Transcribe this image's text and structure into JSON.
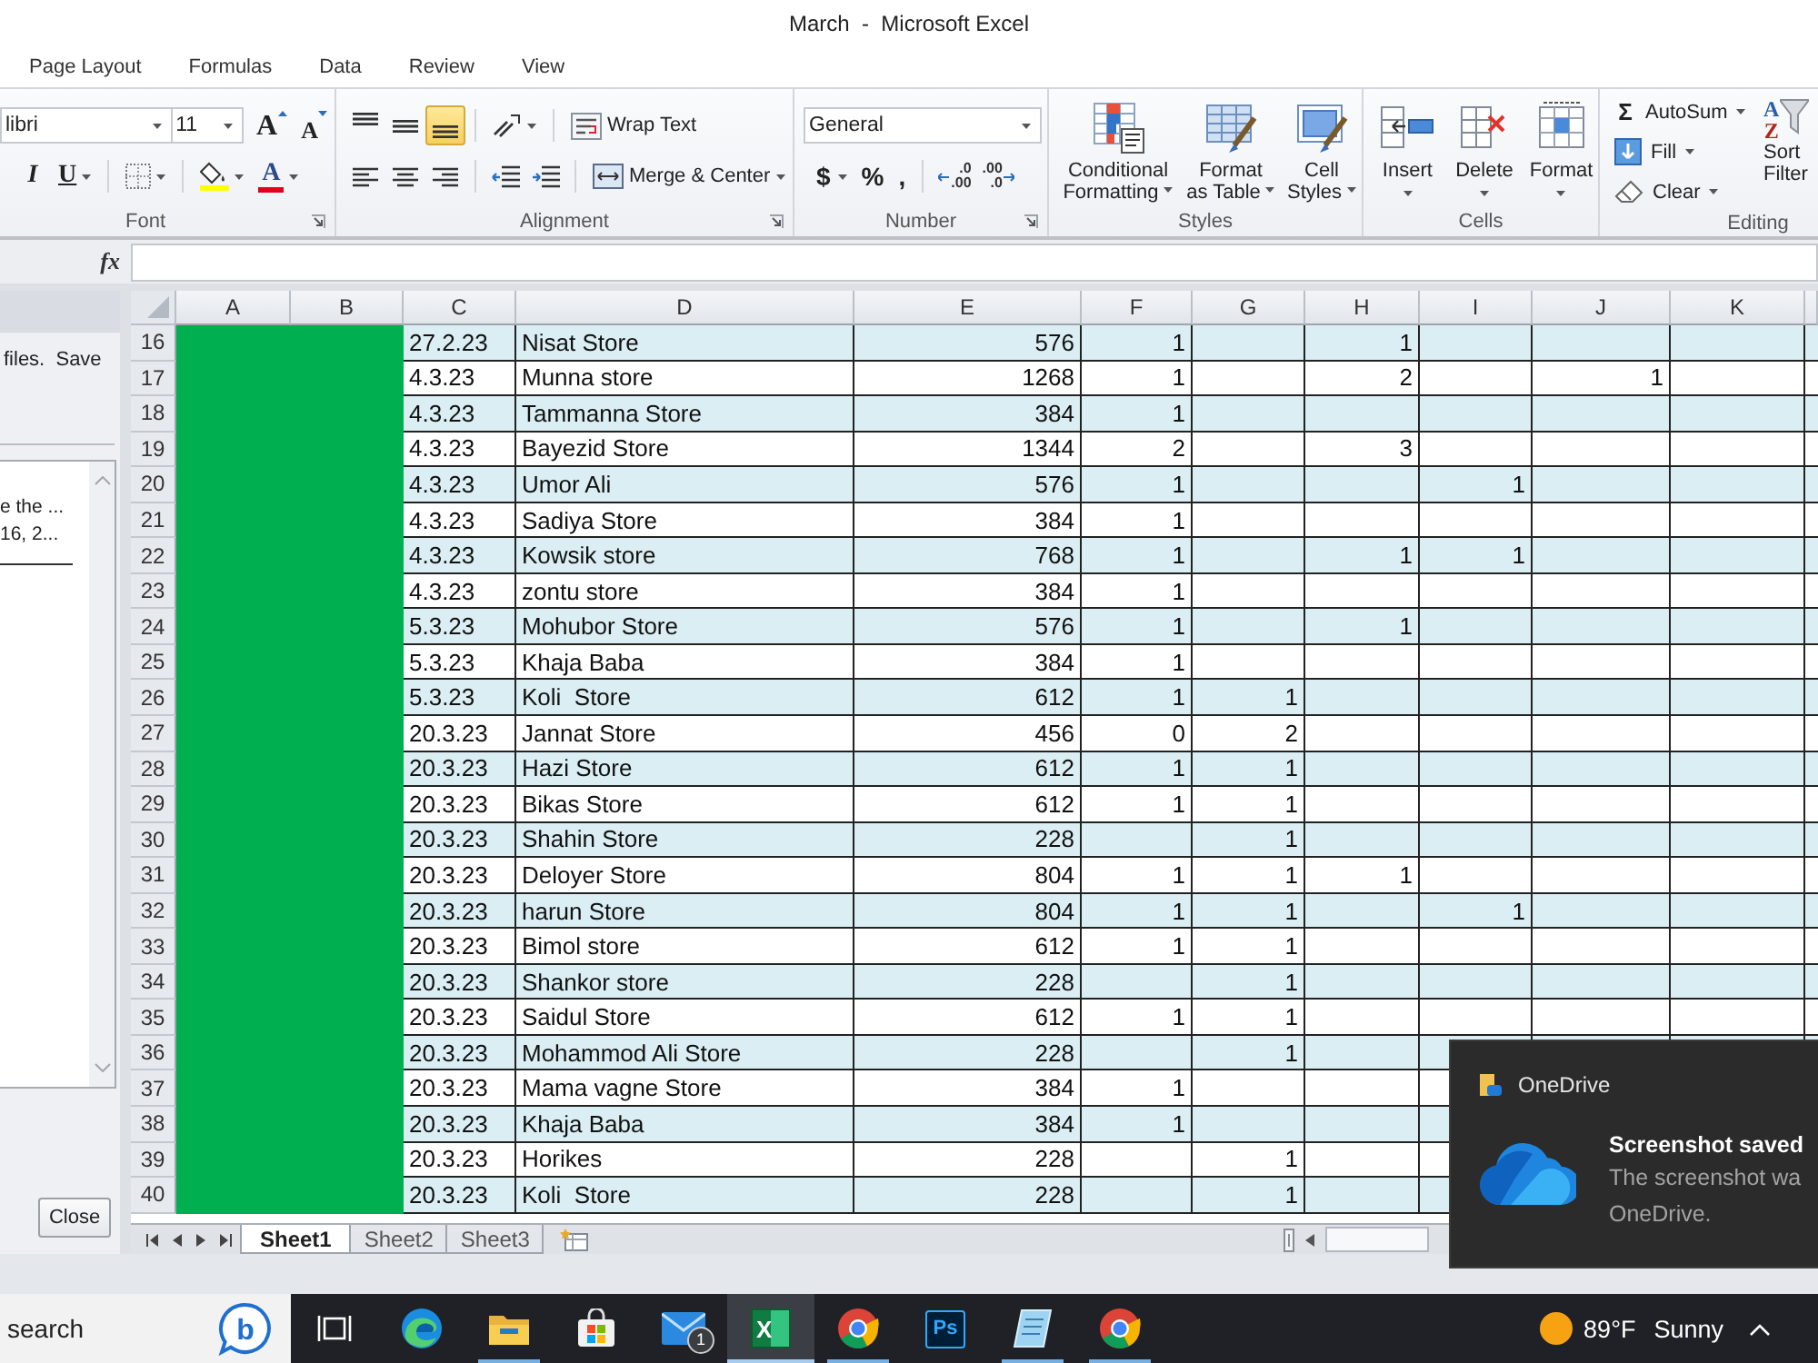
{
  "window": {
    "title": "March  -  Microsoft Excel"
  },
  "ribbon_tabs": [
    "Page Layout",
    "Formulas",
    "Data",
    "Review",
    "View"
  ],
  "ribbon": {
    "font": {
      "label": "Font",
      "font_name": "libri",
      "font_size": "11",
      "grow_font": "A",
      "shrink_font": "A",
      "italic": "I",
      "underline": "U",
      "font_color": "A"
    },
    "alignment": {
      "label": "Alignment",
      "vertical_align": [
        {
          "selected": false
        },
        {
          "selected": false
        },
        {
          "selected": true
        }
      ],
      "horizontal_align": [
        {
          "selected": false
        },
        {
          "selected": false
        },
        {
          "selected": false
        }
      ],
      "wrap_text": "Wrap Text",
      "merge_center": "Merge & Center"
    },
    "number": {
      "label": "Number",
      "format": "General",
      "currency": "$",
      "percent": "%",
      "comma": ",",
      "increase_decimal": [
        ".0",
        ".00"
      ],
      "decrease_decimal": [
        ".00",
        ".0"
      ]
    },
    "styles": {
      "label": "Styles",
      "buttons": [
        {
          "lines": [
            "Conditional",
            "Formatting"
          ]
        },
        {
          "lines": [
            "Format",
            "as Table"
          ]
        },
        {
          "lines": [
            "Cell",
            "Styles"
          ]
        }
      ]
    },
    "cells": {
      "label": "Cells",
      "buttons": [
        "Insert",
        "Delete",
        "Format"
      ]
    },
    "editing": {
      "label": "Editing",
      "autosum_symbol": "Σ",
      "autosum": "AutoSum",
      "fill": "Fill",
      "clear": "Clear",
      "sort_letters": [
        "A",
        "Z"
      ],
      "sort_filter": [
        "Sort",
        "Filter"
      ]
    }
  },
  "formula_bar": {
    "function_label": "fx"
  },
  "task_pane": {
    "message": "files.  Save",
    "recovered_files": [
      "e the ...",
      "16, 2..."
    ],
    "close": "Close"
  },
  "sheet": {
    "columns": [
      "A",
      "B",
      "C",
      "D",
      "E",
      "F",
      "G",
      "H",
      "I",
      "J",
      "K"
    ],
    "rows": [
      {
        "number": "16",
        "c": "27.2.23",
        "d": "Nisat Store",
        "e": "576",
        "f": "1",
        "h": "1"
      },
      {
        "number": "17",
        "c": "4.3.23",
        "d": "Munna store",
        "e": "1268",
        "f": "1",
        "h": "2",
        "j": "1"
      },
      {
        "number": "18",
        "c": "4.3.23",
        "d": "Tammanna Store",
        "e": "384",
        "f": "1"
      },
      {
        "number": "19",
        "c": "4.3.23",
        "d": "Bayezid Store",
        "e": "1344",
        "f": "2",
        "h": "3"
      },
      {
        "number": "20",
        "c": "4.3.23",
        "d": "Umor Ali",
        "e": "576",
        "f": "1",
        "i": "1"
      },
      {
        "number": "21",
        "c": "4.3.23",
        "d": "Sadiya Store",
        "e": "384",
        "f": "1"
      },
      {
        "number": "22",
        "c": "4.3.23",
        "d": "Kowsik store",
        "e": "768",
        "f": "1",
        "h": "1",
        "i": "1"
      },
      {
        "number": "23",
        "c": "4.3.23",
        "d": "zontu store",
        "e": "384",
        "f": "1"
      },
      {
        "number": "24",
        "c": "5.3.23",
        "d": "Mohubor Store",
        "e": "576",
        "f": "1",
        "h": "1"
      },
      {
        "number": "25",
        "c": "5.3.23",
        "d": "Khaja Baba",
        "e": "384",
        "f": "1"
      },
      {
        "number": "26",
        "c": "5.3.23",
        "d": "Koli  Store",
        "e": "612",
        "f": "1",
        "g": "1"
      },
      {
        "number": "27",
        "c": "20.3.23",
        "d": "Jannat Store",
        "e": "456",
        "f": "0",
        "g": "2"
      },
      {
        "number": "28",
        "c": "20.3.23",
        "d": "Hazi Store",
        "e": "612",
        "f": "1",
        "g": "1"
      },
      {
        "number": "29",
        "c": "20.3.23",
        "d": "Bikas Store",
        "e": "612",
        "f": "1",
        "g": "1"
      },
      {
        "number": "30",
        "c": "20.3.23",
        "d": "Shahin Store",
        "e": "228",
        "g": "1"
      },
      {
        "number": "31",
        "c": "20.3.23",
        "d": "Deloyer Store",
        "e": "804",
        "f": "1",
        "g": "1",
        "h": "1"
      },
      {
        "number": "32",
        "c": "20.3.23",
        "d": "harun Store",
        "e": "804",
        "f": "1",
        "g": "1",
        "i": "1"
      },
      {
        "number": "33",
        "c": "20.3.23",
        "d": "Bimol store",
        "e": "612",
        "f": "1",
        "g": "1"
      },
      {
        "number": "34",
        "c": "20.3.23",
        "d": "Shankor store",
        "e": "228",
        "g": "1"
      },
      {
        "number": "35",
        "c": "20.3.23",
        "d": "Saidul Store",
        "e": "612",
        "f": "1",
        "g": "1"
      },
      {
        "number": "36",
        "c": "20.3.23",
        "d": "Mohammod Ali Store",
        "e": "228",
        "g": "1"
      },
      {
        "number": "37",
        "c": "20.3.23",
        "d": "Mama vagne Store",
        "e": "384",
        "f": "1"
      },
      {
        "number": "38",
        "c": "20.3.23",
        "d": "Khaja Baba",
        "e": "384",
        "f": "1"
      },
      {
        "number": "39",
        "c": "20.3.23",
        "d": "Horikes",
        "e": "228",
        "g": "1"
      },
      {
        "number": "40",
        "c": "20.3.23",
        "d": "Koli  Store",
        "e": "228",
        "g": "1"
      }
    ]
  },
  "sheet_tabs": [
    {
      "label": "Sheet1",
      "selected": true
    },
    {
      "label": "Sheet2",
      "selected": false
    },
    {
      "label": "Sheet3",
      "selected": false
    }
  ],
  "taskbar": {
    "search": {
      "placeholder": "search",
      "assistant_label": "b"
    },
    "apps": [
      {
        "kind": "taskview",
        "running": false,
        "selected": false
      },
      {
        "kind": "swirl",
        "running": false,
        "selected": false
      },
      {
        "kind": "folder",
        "running": true,
        "selected": false
      },
      {
        "kind": "store",
        "running": false,
        "selected": false
      },
      {
        "kind": "mail",
        "running": false,
        "selected": false,
        "badge": "1"
      },
      {
        "kind": "sheet",
        "running": true,
        "selected": true,
        "label": "X"
      },
      {
        "kind": "browser",
        "running": true,
        "selected": false
      },
      {
        "kind": "tile",
        "running": false,
        "selected": false,
        "label": "Ps"
      },
      {
        "kind": "notes",
        "running": true,
        "selected": false
      },
      {
        "kind": "browser",
        "running": true,
        "selected": false
      }
    ],
    "weather": {
      "temperature": "89°F",
      "condition": "Sunny"
    }
  },
  "toast": {
    "app": "OneDrive",
    "title": "Screenshot saved",
    "body": [
      "The screenshot wa",
      "OneDrive."
    ]
  }
}
